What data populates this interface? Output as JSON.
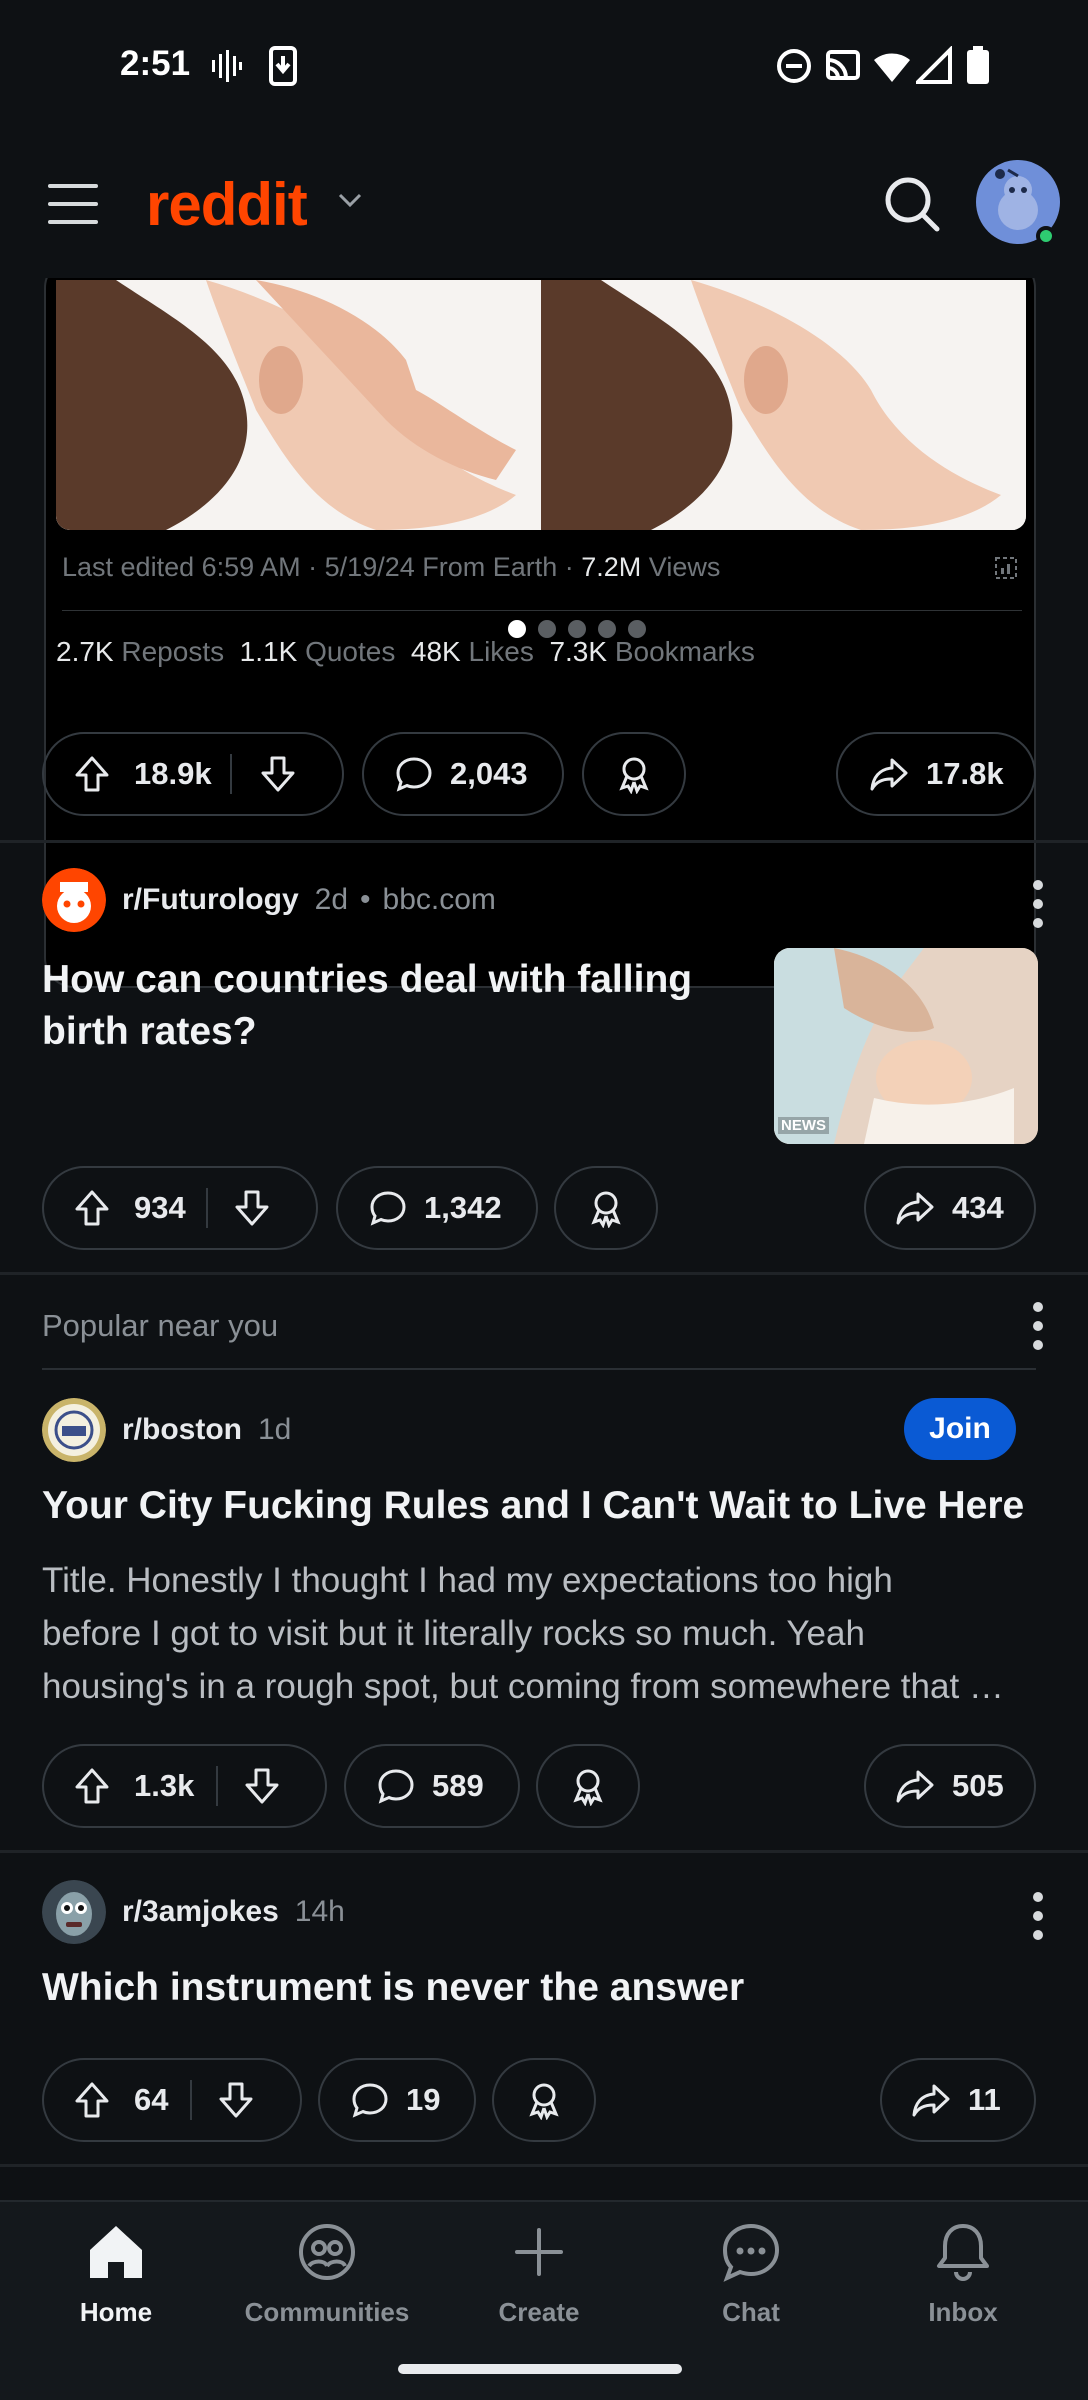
{
  "status_bar": {
    "time": "2:51"
  },
  "app_bar": {
    "logo": "reddit"
  },
  "embed": {
    "meta_prefix": "Last edited 6:59 AM · 5/19/24 From Earth · ",
    "views_count": "7.2M",
    "views_label": " Views",
    "stats": [
      {
        "count": "2.7K",
        "label": "Reposts"
      },
      {
        "count": "1.1K",
        "label": "Quotes"
      },
      {
        "count": "48K",
        "label": "Likes"
      },
      {
        "count": "7.3K",
        "label": "Bookmarks"
      }
    ]
  },
  "posts": [
    {
      "upvotes": "18.9k",
      "comments": "2,043",
      "shares": "17.8k"
    },
    {
      "subreddit": "r/Futurology",
      "age": "2d",
      "source": "bbc.com",
      "title_line1": "How can countries deal with falling",
      "title_line2": "birth rates?",
      "thumb_badge": "NEWS",
      "upvotes": "934",
      "comments": "1,342",
      "shares": "434"
    },
    {
      "section": "Popular near you",
      "subreddit": "r/boston",
      "age": "1d",
      "join_label": "Join",
      "title": "Your City Fucking Rules and I Can't Wait to Live Here",
      "body_line1": "Title. Honestly I thought I had my expectations too high",
      "body_line2": "before I got to visit but it literally rocks so much. Yeah",
      "body_line3": "housing's in a rough spot, but coming from somewhere that …",
      "upvotes": "1.3k",
      "comments": "589",
      "shares": "505"
    },
    {
      "subreddit": "r/3amjokes",
      "age": "14h",
      "title": "Which instrument is never the answer",
      "upvotes": "64",
      "comments": "19",
      "shares": "11"
    }
  ],
  "bottom_nav": [
    {
      "label": "Home",
      "icon": "home-icon",
      "active": true
    },
    {
      "label": "Communities",
      "icon": "communities-icon"
    },
    {
      "label": "Create",
      "icon": "plus-icon"
    },
    {
      "label": "Chat",
      "icon": "chat-icon"
    },
    {
      "label": "Inbox",
      "icon": "bell-icon"
    }
  ],
  "colors": {
    "accent": "#ff4500",
    "join": "#0a5ad4",
    "background": "#0e1114"
  }
}
